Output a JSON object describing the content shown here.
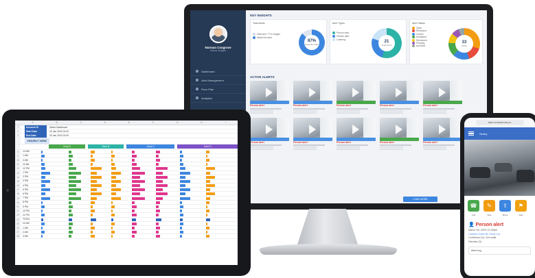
{
  "monitor": {
    "section_title": "KEY INSIGHTS",
    "user": {
      "name": "Norman Cosgrove",
      "role": "Senior Analyst"
    },
    "nav": [
      "Dashboard",
      "Alert Management",
      "Floor Plan",
      "Analytics"
    ],
    "kpi1": {
      "title": "Total Alerts",
      "legend": [
        "Detected: 77% images",
        "Watch list alert"
      ],
      "center_value": "87%",
      "center_label": "Detection Rate"
    },
    "kpi2": {
      "title": "Alert Types",
      "legend": [
        "Person alert",
        "Vehicle alert",
        "Loitering"
      ],
      "center_value": "21",
      "center_label": "Total Alerts"
    },
    "kpi3": {
      "title": "Alert Status",
      "legend": [
        "Open",
        "Reviewed",
        "Closed",
        "Escalated",
        "Dismissed",
        "Pending",
        "Archived"
      ],
      "center_value": "33",
      "center_label": "Active"
    },
    "alerts_title": "ACTIVE ALERTS",
    "alert_label": "Person alert",
    "load_more": "LOAD MORE"
  },
  "tablet": {
    "columns": [
      "A",
      "B",
      "C",
      "D",
      "E",
      "F",
      "G",
      "H",
      "I"
    ],
    "info_rows": [
      [
        "Account ID",
        "Sales Dashboard"
      ],
      [
        "Start Date",
        "03 Jan 2023 01:00"
      ],
      [
        "End Date",
        "03 Jan 2023 23:00"
      ]
    ],
    "sheet_title": "HOURLY VIEW",
    "groups": [
      "Zone A",
      "Zone B",
      "Zone C",
      "Zone D"
    ],
    "rows": [
      "12 AM",
      "1 AM",
      "2 AM",
      "11 AM",
      "12 PM",
      "1 PM",
      "2 PM",
      "3 PM",
      "4 PM",
      "5 PM",
      "6 PM",
      "7 PM",
      "8 PM",
      "9 PM",
      "10 PM",
      "11 PM",
      "TOTAL",
      "12 AM",
      "1 AM",
      "2 AM",
      "3 AM"
    ]
  },
  "phone": {
    "url": "alert.smartsentry.io",
    "app_name": "Sentry",
    "actions": [
      "Call",
      "Note",
      "Share",
      "Flag"
    ],
    "alert_title": "Person alert",
    "alert_time": "March 04, 2023 12:30am",
    "details": [
      "Camera Zone 06, Front Lot",
      "Confirmed (1), 2nd walk",
      "Dismiss (0)"
    ],
    "field_label": "Alert log"
  },
  "colors": {
    "blue": "#3d86e0",
    "green": "#49a84c",
    "orange": "#f39c12",
    "magenta": "#e0368d",
    "red": "#d9342b",
    "navy": "#263a55",
    "teal": "#2bb3a6",
    "purple": "#7b52c7"
  }
}
